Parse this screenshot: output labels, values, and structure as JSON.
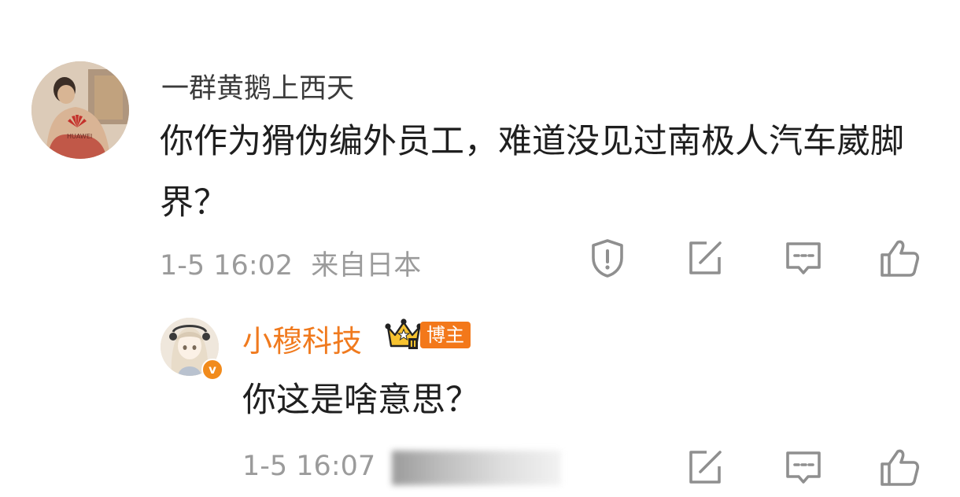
{
  "comment": {
    "username": "一群黄鹅上西天",
    "text": "你作为猾伪编外员工，难道没见过南极人汽车崴脚界？",
    "time": "1-5 16:02",
    "location": "来自日本",
    "avatar_logo_text": "HUAWEI",
    "actions": [
      "report-icon",
      "share-icon",
      "comment-icon",
      "like-icon"
    ]
  },
  "reply": {
    "username": "小穆科技",
    "badge": "博主",
    "crown_level": "II",
    "verified_mark": "v",
    "text": "你这是啥意思？",
    "time": "1-5 16:07",
    "location_obscured": true,
    "actions": [
      "share-icon",
      "comment-icon",
      "like-icon"
    ]
  },
  "colors": {
    "username_reply": "#f07a1e",
    "badge_bg": "#f3781a",
    "meta": "#9b9b9b",
    "text": "#1f1f1f"
  }
}
